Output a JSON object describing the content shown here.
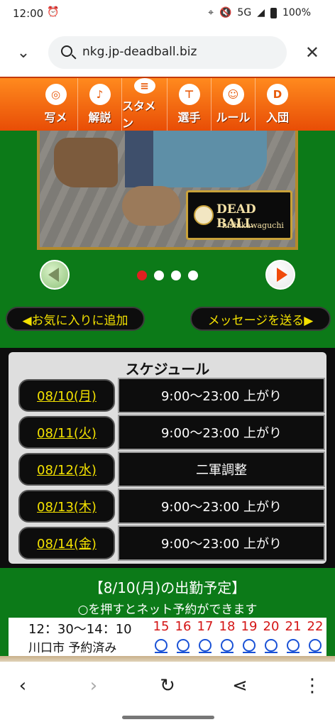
{
  "status": {
    "time": "12:00",
    "network": "5G",
    "battery": "100%"
  },
  "browser": {
    "url": "nkg.jp-deadball.biz"
  },
  "nav": [
    {
      "label": "写メ",
      "icon": "camera-ball-icon"
    },
    {
      "label": "解説",
      "icon": "microphone-icon"
    },
    {
      "label": "スタメン",
      "icon": "clipboard-icon"
    },
    {
      "label": "選手",
      "icon": "uniform-icon"
    },
    {
      "label": "ルール",
      "icon": "umpire-icon"
    },
    {
      "label": "入団",
      "icon": "cap-icon"
    }
  ],
  "banner": {
    "logo_title": "DEAD BALL",
    "logo_subtitle": "nishikawaguchi",
    "slides": 4,
    "active_slide": 1
  },
  "actions": {
    "favorite": "◀お気に入りに追加",
    "message": "メッセージを送る▶"
  },
  "schedule": {
    "title": "スケジュール",
    "rows": [
      {
        "date": "08/10(月)",
        "value": "9:00〜23:00 上がり"
      },
      {
        "date": "08/11(火)",
        "value": "9:00〜23:00 上がり"
      },
      {
        "date": "08/12(水)",
        "value": "二軍調整"
      },
      {
        "date": "08/13(木)",
        "value": "9:00〜23:00 上がり"
      },
      {
        "date": "08/14(金)",
        "value": "9:00〜23:00 上がり"
      }
    ]
  },
  "attendance": {
    "title": "【8/10(月)の出勤予定】",
    "note": "○を押すとネット予約ができます",
    "time": "12：30〜14：10",
    "location": "川口市 予約済み",
    "hours": [
      "15",
      "16",
      "17",
      "18",
      "19",
      "20",
      "21",
      "22"
    ]
  },
  "colors": {
    "nav_orange": "#f06a12",
    "field_green": "#0c7a18",
    "accent_yellow": "#f3e100",
    "hour_red": "#d41616",
    "slot_blue": "#1a52d6"
  }
}
